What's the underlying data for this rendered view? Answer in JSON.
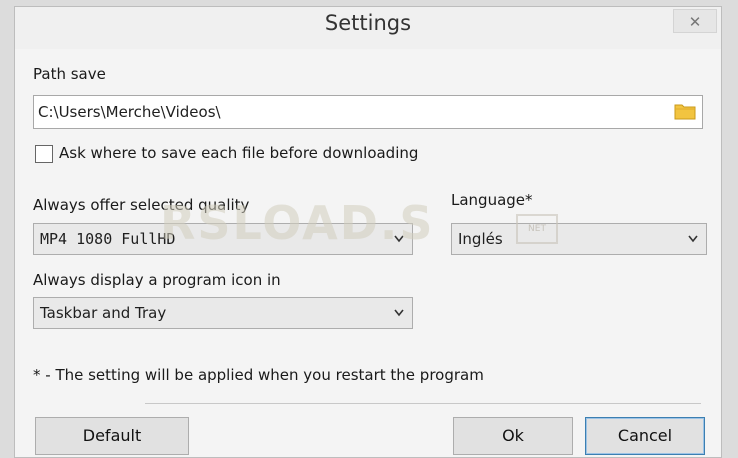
{
  "window": {
    "title": "Settings",
    "close_glyph": "✕"
  },
  "path_save": {
    "label": "Path save",
    "value": "C:\\Users\\Merche\\Videos\\",
    "browse_icon": "folder-icon"
  },
  "ask_checkbox": {
    "label": "Ask where to save each file before downloading",
    "checked": false
  },
  "quality": {
    "label": "Always offer selected quality",
    "value": "MP4 1080 FullHD"
  },
  "language": {
    "label": "Language*",
    "value": "Inglés"
  },
  "program_icon": {
    "label": "Always display a program icon in",
    "value": "Taskbar and Tray"
  },
  "note": "* - The setting will be applied when you restart the program",
  "buttons": {
    "default": "Default",
    "ok": "Ok",
    "cancel": "Cancel"
  },
  "watermark": {
    "text": "RSLOAD.S",
    "badge": "NET"
  },
  "colors": {
    "folder": "#f2c440",
    "focus_border": "#3c7fb1"
  }
}
